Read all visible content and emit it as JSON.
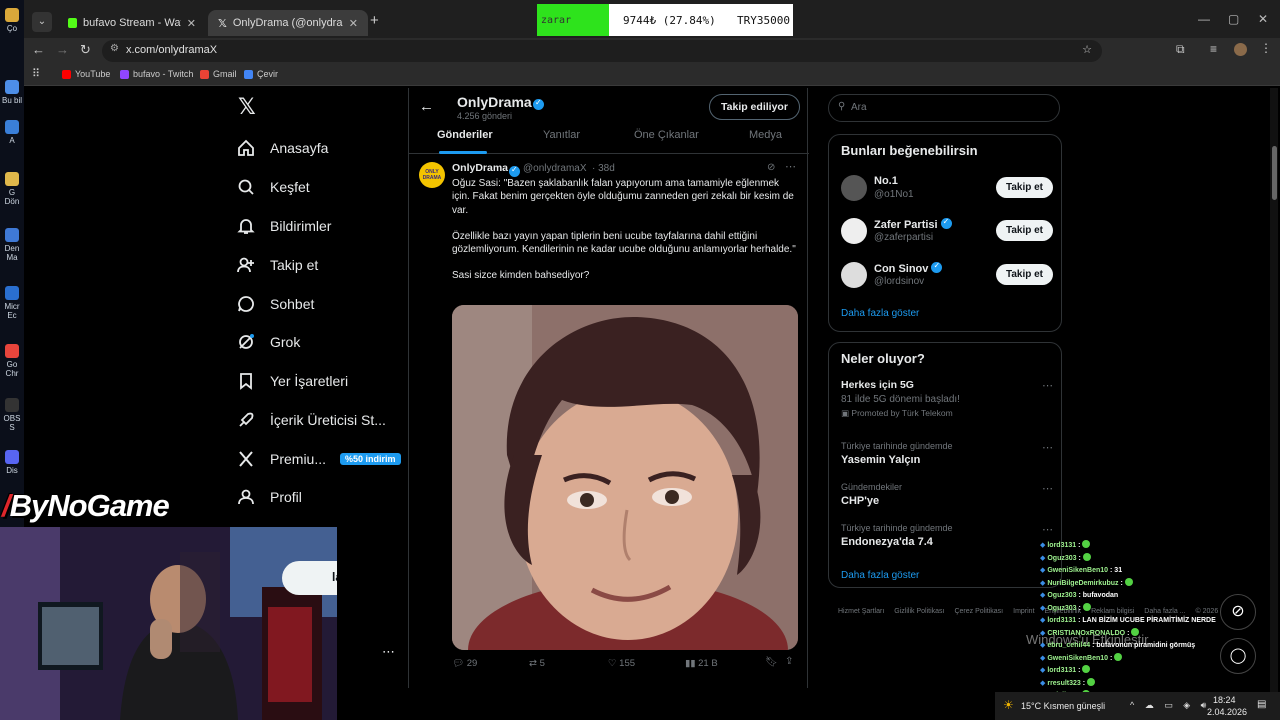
{
  "desktop": {
    "icons": [
      {
        "label": "Ço",
        "color": "#d9a83a"
      },
      {
        "label": "Bu bil",
        "color": "#4d8ee8"
      },
      {
        "label": "A",
        "color": "#3a7fd8"
      },
      {
        "label": "G Dön",
        "color": "#e0b84b"
      },
      {
        "label": "Den Ma",
        "color": "#3f79d6"
      },
      {
        "label": "Micr Ec",
        "color": "#2a6fd0"
      },
      {
        "label": "Go Chr",
        "color": "#e8453c"
      },
      {
        "label": "OBS S",
        "color": "#333333"
      },
      {
        "label": "Dis",
        "color": "#5865f2"
      }
    ]
  },
  "browser": {
    "tabs": [
      {
        "title": "bufavo Stream - Watch Live on",
        "favicon_color": "#53fc18"
      },
      {
        "title": "OnlyDrama (@onlydramaX) / X",
        "favicon_color": "#ffffff"
      }
    ],
    "url": "x.com/onlydramaX",
    "bookmarks": [
      {
        "label": "YouTube",
        "color": "#ff0000"
      },
      {
        "label": "bufavo - Twitch",
        "color": "#9146ff"
      },
      {
        "label": "Gmail",
        "color": "#ea4335"
      },
      {
        "label": "Çevir",
        "color": "#4285f4"
      }
    ]
  },
  "overlay": {
    "label": "zarar",
    "amount": "9744₺ (27.84%)",
    "goal": "TRY35000",
    "progress_percent": 27.84
  },
  "nav": {
    "items": [
      {
        "label": "Anasayfa",
        "icon": "home-icon"
      },
      {
        "label": "Keşfet",
        "icon": "search-icon"
      },
      {
        "label": "Bildirimler",
        "icon": "bell-icon"
      },
      {
        "label": "Takip et",
        "icon": "follow-icon"
      },
      {
        "label": "Sohbet",
        "icon": "chat-icon"
      },
      {
        "label": "Grok",
        "icon": "grok-icon"
      },
      {
        "label": "Yer İşaretleri",
        "icon": "bookmark-icon"
      },
      {
        "label": "İçerik Üreticisi St...",
        "icon": "rocket-icon"
      },
      {
        "label": "Premiu...",
        "icon": "x-logo-icon"
      },
      {
        "label": "Profil",
        "icon": "profile-icon"
      }
    ],
    "premium_badge": "%50 indirim",
    "post_button": "la"
  },
  "profile": {
    "name": "OnlyDrama",
    "posts_count": "4.256 gönderi",
    "follow_button": "Takip ediliyor",
    "tabs": [
      "Gönderiler",
      "Yanıtlar",
      "Öne Çıkanlar",
      "Medya"
    ],
    "active_tab": "Gönderiler"
  },
  "tweet": {
    "author": "OnlyDrama",
    "handle": "@onlydramaX",
    "time": "· 38d",
    "avatar_text": "ONLY DRAMA",
    "line1": "Oğuz Sasi: \"Bazen şaklabanlık falan yapıyorum ama tamamiyle eğlenmek için. Fakat benim gerçekten öyle olduğumu zanneden geri zekalı bir kesim de var.",
    "line2": "Özellikle bazı yayın yapan tiplerin beni ucube tayfalarına dahil ettiğini gözlemliyorum. Kendilerinin ne kadar ucube olduğunu anlamıyorlar herhalde.\"",
    "line3": "Sasi sizce kimden bahsediyor?",
    "stats": {
      "replies": "29",
      "reposts": "5",
      "likes": "155",
      "views": "21 B"
    }
  },
  "right": {
    "search_placeholder": "Ara",
    "who_title": "Bunları beğenebilirsin",
    "who": [
      {
        "name": "No.1",
        "handle": "@o1No1",
        "verified": false,
        "button": "Takip et",
        "color": "#555555"
      },
      {
        "name": "Zafer Partisi",
        "handle": "@zaferpartisi",
        "verified": true,
        "button": "Takip et",
        "color": "#eeeeee"
      },
      {
        "name": "Con Sinov",
        "handle": "@lordsinov",
        "verified": true,
        "button": "Takip et",
        "color": "#dddddd"
      }
    ],
    "show_more": "Daha fazla göster",
    "trends_title": "Neler oluyor?",
    "trends": [
      {
        "meta": "Herkes için 5G",
        "title": "81 ilde 5G dönemi başladı!",
        "promo": "Promoted by Türk Telekom",
        "kind": "ad"
      },
      {
        "meta": "Türkiye tarihinde gündemde",
        "title": "Yasemin Yalçın"
      },
      {
        "meta": "Gündemdekiler",
        "title": "CHP'ye"
      },
      {
        "meta": "Türkiye tarihinde gündemde",
        "title": "Endonezya'da 7.4"
      }
    ],
    "footer": [
      "Hizmet Şartları",
      "Gizlilik Politikası",
      "Çerez Politikası",
      "Imprint",
      "Erişilebilirlik",
      "Reklam bilgisi",
      "Daha fazla ...",
      "© 2026 X Corp."
    ]
  },
  "streamer": {
    "logo": "ByNoGame"
  },
  "chat": [
    {
      "user": "lord3131",
      "text": ""
    },
    {
      "user": "Oguz303",
      "text": ""
    },
    {
      "user": "GweniSikenBen10",
      "text": "31"
    },
    {
      "user": "NuriBilgeDemirkubuz",
      "text": ""
    },
    {
      "user": "Oguz303",
      "text": "bufavodan"
    },
    {
      "user": "Oguz303",
      "text": ""
    },
    {
      "user": "lord3131",
      "text": "LAN BİZİM UCUBE PİRAMİTİMİZ NERDE"
    },
    {
      "user": "CRISTIANOxRONALDO",
      "text": ""
    },
    {
      "user": "ebru_cehil44",
      "text": "bufavonun piramidini görmüş"
    },
    {
      "user": "GweniSikenBen10",
      "text": ""
    },
    {
      "user": "lord3131",
      "text": ""
    },
    {
      "user": "rresult323",
      "text": ""
    },
    {
      "user": "Kelsiken",
      "text": ""
    }
  ],
  "taskbar": {
    "weather": "15°C Kısmen güneşli",
    "time": "18:24",
    "date": "2.04.2026"
  },
  "watermark": "Windows'u Etkinleştir"
}
